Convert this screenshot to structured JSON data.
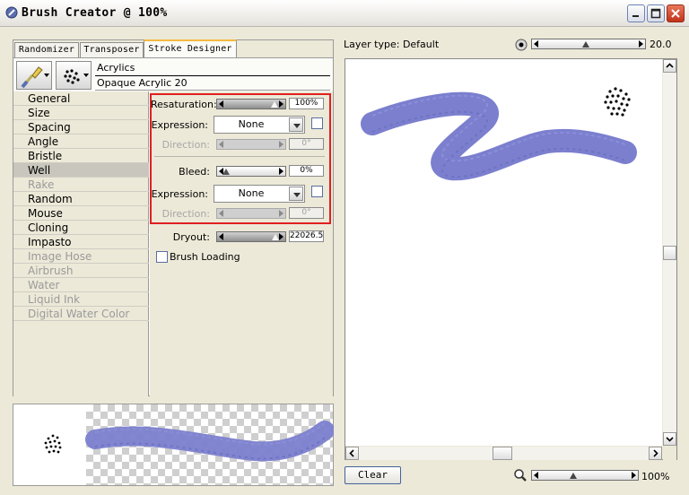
{
  "window": {
    "title": "Brush Creator @ 100%"
  },
  "tabs": [
    {
      "label": "Randomizer"
    },
    {
      "label": "Transposer"
    },
    {
      "label": "Stroke Designer",
      "active": true
    }
  ],
  "brush": {
    "category": "Acrylics",
    "variant": "Opaque Acrylic 20"
  },
  "menu": [
    {
      "label": "General",
      "enabled": true
    },
    {
      "label": "Size",
      "enabled": true
    },
    {
      "label": "Spacing",
      "enabled": true
    },
    {
      "label": "Angle",
      "enabled": true
    },
    {
      "label": "Bristle",
      "enabled": true
    },
    {
      "label": "Well",
      "enabled": true,
      "selected": true
    },
    {
      "label": "Rake",
      "enabled": false
    },
    {
      "label": "Random",
      "enabled": true
    },
    {
      "label": "Mouse",
      "enabled": true
    },
    {
      "label": "Cloning",
      "enabled": true
    },
    {
      "label": "Impasto",
      "enabled": true
    },
    {
      "label": "Image Hose",
      "enabled": false
    },
    {
      "label": "Airbrush",
      "enabled": false
    },
    {
      "label": "Water",
      "enabled": false
    },
    {
      "label": "Liquid Ink",
      "enabled": false
    },
    {
      "label": "Digital Water Color",
      "enabled": false
    }
  ],
  "well": {
    "resaturation": {
      "label": "Resaturation:",
      "value": "100%",
      "level": 1.0
    },
    "expression1": {
      "label": "Expression:",
      "value": "None",
      "checked": false
    },
    "direction1": {
      "label": "Direction:",
      "value": "0°",
      "enabled": false
    },
    "bleed": {
      "label": "Bleed:",
      "value": "0%",
      "level": 0.0
    },
    "expression2": {
      "label": "Expression:",
      "value": "None",
      "checked": false
    },
    "direction2": {
      "label": "Direction:",
      "value": "0°",
      "enabled": false
    },
    "dryout": {
      "label": "Dryout:",
      "value": "22026.5",
      "level": 1.0
    },
    "brush_loading": {
      "label": "Brush Loading",
      "checked": false
    }
  },
  "preview": {
    "layer_type": "Layer type: Default",
    "stroke_color": "#7b7fce"
  },
  "controls": {
    "size_value": "20.0",
    "size_level": 0.45,
    "zoom_value": "100%",
    "zoom_level": 0.38,
    "clear_label": "Clear"
  }
}
